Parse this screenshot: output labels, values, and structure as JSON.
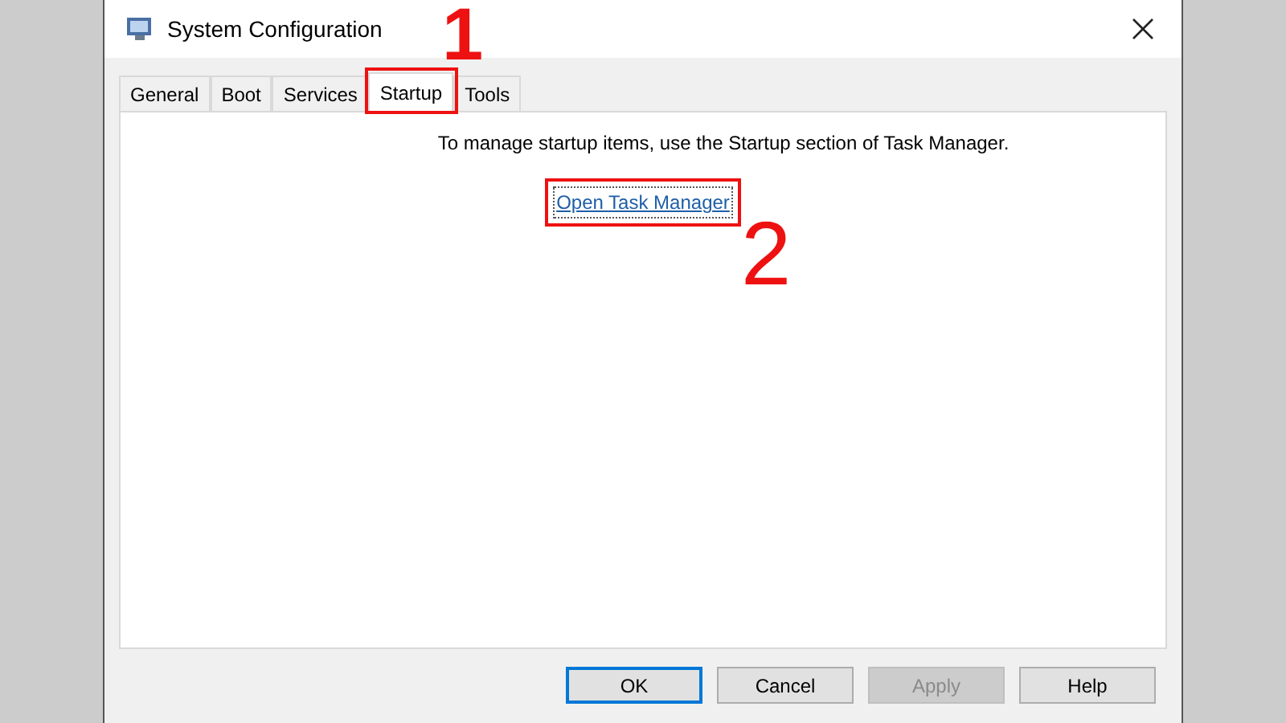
{
  "window": {
    "title": "System Configuration"
  },
  "tabs": [
    {
      "label": "General",
      "selected": false
    },
    {
      "label": "Boot",
      "selected": false
    },
    {
      "label": "Services",
      "selected": false
    },
    {
      "label": "Startup",
      "selected": true
    },
    {
      "label": "Tools",
      "selected": false
    }
  ],
  "message": "To manage startup items, use the Startup section of Task Manager.",
  "link": "Open Task Manager",
  "buttons": [
    {
      "label": "OK",
      "default": true,
      "disabled": false
    },
    {
      "label": "Cancel",
      "default": false,
      "disabled": false
    },
    {
      "label": "Apply",
      "default": false,
      "disabled": true
    },
    {
      "label": "Help",
      "default": false,
      "disabled": false
    }
  ],
  "annotations": [
    {
      "label": "1",
      "kind": "tab"
    },
    {
      "label": "2",
      "kind": "link"
    }
  ]
}
